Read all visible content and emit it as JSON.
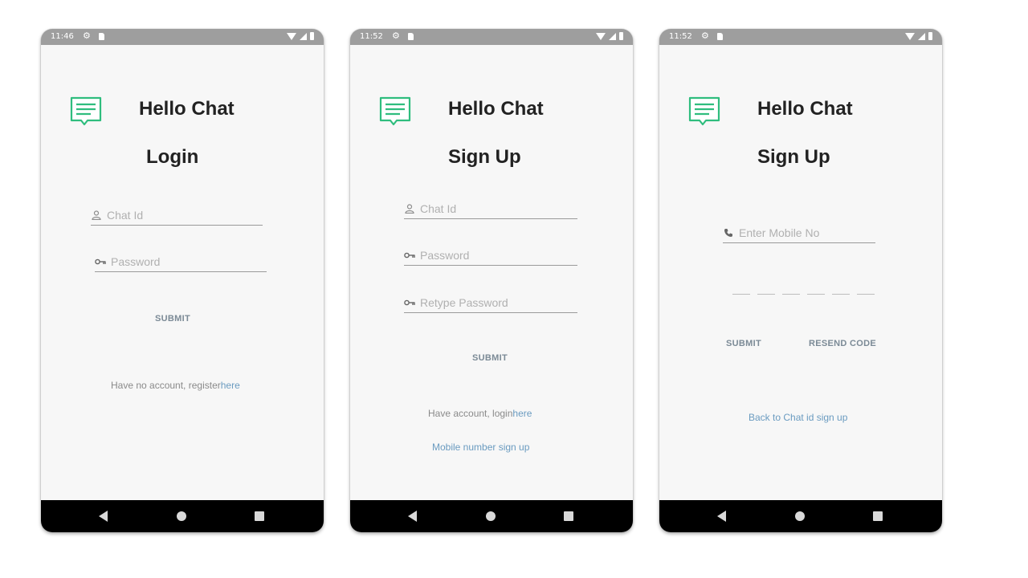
{
  "status_times": [
    "11:46",
    "11:52",
    "11:52"
  ],
  "app_name": "Hello Chat",
  "login": {
    "title": "Login",
    "chat_id_placeholder": "Chat Id",
    "password_placeholder": "Password",
    "submit": "SUBMIT",
    "register_prefix": "Have no account, register",
    "register_link": "here"
  },
  "signup": {
    "title": "Sign Up",
    "chat_id_placeholder": "Chat Id",
    "password_placeholder": "Password",
    "retype_placeholder": "Retype Password",
    "submit": "SUBMIT",
    "login_prefix": "Have account, login",
    "login_link": "here",
    "mobile_link": "Mobile number sign up"
  },
  "mobile": {
    "title": "Sign Up",
    "mobile_placeholder": "Enter Mobile No",
    "submit": "SUBMIT",
    "resend": "RESEND CODE",
    "back_link": "Back to Chat id sign up"
  },
  "colors": {
    "accent": "#2fbd7e",
    "status_bar": "#9e9e9e",
    "nav_bar": "#000000",
    "link": "#6a9bc0"
  },
  "icons": [
    "chat-logo-icon",
    "person-icon",
    "key-icon",
    "phone-icon",
    "settings-icon",
    "sd-card-icon",
    "wifi-icon",
    "signal-icon",
    "battery-icon",
    "back-icon",
    "home-icon",
    "recent-apps-icon"
  ]
}
